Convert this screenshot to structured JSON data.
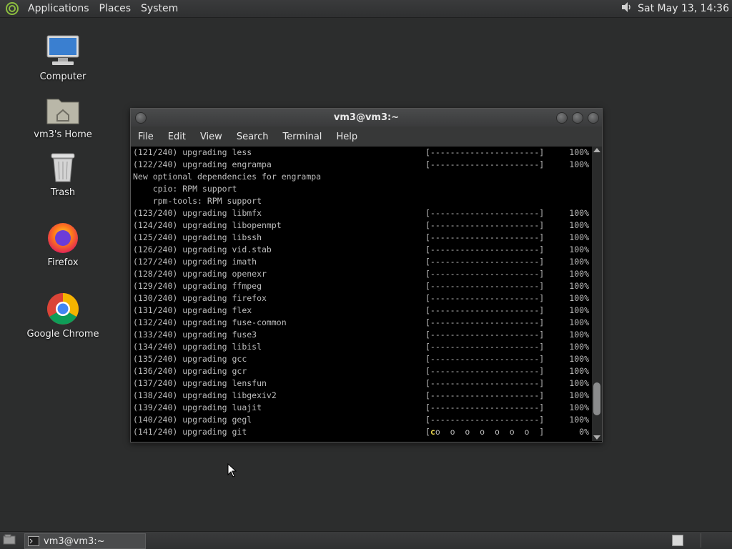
{
  "top_panel": {
    "menus": [
      "Applications",
      "Places",
      "System"
    ],
    "clock": "Sat May 13, 14:36"
  },
  "desktop": {
    "icons": [
      {
        "label": "Computer",
        "icon": "computer-icon"
      },
      {
        "label": "vm3's Home",
        "icon": "home-folder-icon"
      },
      {
        "label": "Trash",
        "icon": "trash-icon"
      },
      {
        "label": "Firefox",
        "icon": "firefox-icon"
      },
      {
        "label": "Google Chrome",
        "icon": "chrome-icon"
      }
    ]
  },
  "window": {
    "title": "vm3@vm3:~",
    "menu": [
      "File",
      "Edit",
      "View",
      "Search",
      "Terminal",
      "Help"
    ]
  },
  "terminal": {
    "lines": [
      {
        "text": "(121/240) upgrading less",
        "bar": "[----------------------]",
        "pct": "100%"
      },
      {
        "text": "(122/240) upgrading engrampa",
        "bar": "[----------------------]",
        "pct": "100%"
      },
      {
        "text": "New optional dependencies for engrampa",
        "bar": "",
        "pct": ""
      },
      {
        "text": "    cpio: RPM support",
        "bar": "",
        "pct": ""
      },
      {
        "text": "    rpm-tools: RPM support",
        "bar": "",
        "pct": ""
      },
      {
        "text": "(123/240) upgrading libmfx",
        "bar": "[----------------------]",
        "pct": "100%"
      },
      {
        "text": "(124/240) upgrading libopenmpt",
        "bar": "[----------------------]",
        "pct": "100%"
      },
      {
        "text": "(125/240) upgrading libssh",
        "bar": "[----------------------]",
        "pct": "100%"
      },
      {
        "text": "(126/240) upgrading vid.stab",
        "bar": "[----------------------]",
        "pct": "100%"
      },
      {
        "text": "(127/240) upgrading imath",
        "bar": "[----------------------]",
        "pct": "100%"
      },
      {
        "text": "(128/240) upgrading openexr",
        "bar": "[----------------------]",
        "pct": "100%"
      },
      {
        "text": "(129/240) upgrading ffmpeg",
        "bar": "[----------------------]",
        "pct": "100%"
      },
      {
        "text": "(130/240) upgrading firefox",
        "bar": "[----------------------]",
        "pct": "100%"
      },
      {
        "text": "(131/240) upgrading flex",
        "bar": "[----------------------]",
        "pct": "100%"
      },
      {
        "text": "(132/240) upgrading fuse-common",
        "bar": "[----------------------]",
        "pct": "100%"
      },
      {
        "text": "(133/240) upgrading fuse3",
        "bar": "[----------------------]",
        "pct": "100%"
      },
      {
        "text": "(134/240) upgrading libisl",
        "bar": "[----------------------]",
        "pct": "100%"
      },
      {
        "text": "(135/240) upgrading gcc",
        "bar": "[----------------------]",
        "pct": "100%"
      },
      {
        "text": "(136/240) upgrading gcr",
        "bar": "[----------------------]",
        "pct": "100%"
      },
      {
        "text": "(137/240) upgrading lensfun",
        "bar": "[----------------------]",
        "pct": "100%"
      },
      {
        "text": "(138/240) upgrading libgexiv2",
        "bar": "[----------------------]",
        "pct": "100%"
      },
      {
        "text": "(139/240) upgrading luajit",
        "bar": "[----------------------]",
        "pct": "100%"
      },
      {
        "text": "(140/240) upgrading gegl",
        "bar": "[----------------------]",
        "pct": "100%"
      },
      {
        "text": "(141/240) upgrading git",
        "bar": "[",
        "pacman": "c",
        "bar_rest": "o  o  o  o  o  o  o  ]",
        "pct": "0%"
      }
    ]
  },
  "taskbar": {
    "task_label": "vm3@vm3:~"
  },
  "scroll": {
    "thumb_position": 0.92
  },
  "colors": {
    "pacman": "#e8d44d",
    "terminal_text": "#bdbdbd",
    "desktop": "#2c2d2d"
  }
}
